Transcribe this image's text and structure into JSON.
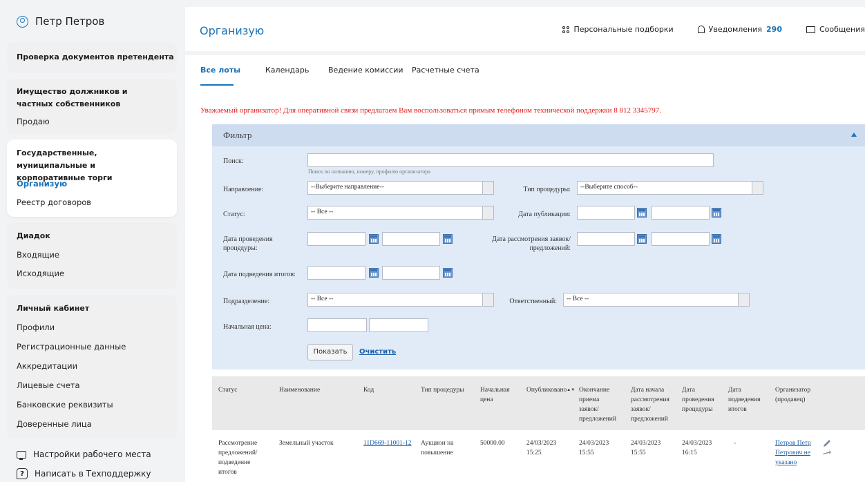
{
  "sidebar": {
    "user_name": "Петр Петров",
    "check_docs": "Проверка документов претендента",
    "property_title": "Имущество должников и частных собственников",
    "sell": "Продаю",
    "gov_title": "Государственные, муниципальные и корпоративные торги",
    "organize": "Организую",
    "contracts": "Реестр договоров",
    "diadoc_title": "Диадок",
    "incoming": "Входящие",
    "outgoing": "Исходящие",
    "cabinet_title": "Личный кабинет",
    "profiles": "Профили",
    "reg_data": "Регистрационные данные",
    "accreditation": "Аккредитации",
    "accounts": "Лицевые счета",
    "bank": "Банковские реквизиты",
    "trusted": "Доверенные лица",
    "workplace": "Настройки рабочего места",
    "support": "Написать в Техподдержку"
  },
  "header": {
    "title": "Организую",
    "personal": "Персональные подборки",
    "notifications": "Уведомления",
    "notifications_count": "290",
    "messages": "Сообщения"
  },
  "tabs": {
    "all_lots": "Все лоты",
    "calendar": "Календарь",
    "commission": "Ведение комиссии",
    "accounts": "Расчетные счета"
  },
  "notice": "Уважаемый организатор! Для оперативной связи предлагаем Вам воспользоваться прямым телефоном технической поддержки 8 812 3345797.",
  "filter": {
    "title": "Фильтр",
    "search_label": "Поиск:",
    "search_hint": "Поиск по названию, номеру, профилю организатора",
    "direction_label": "Направление:",
    "direction_value": "--Выберите направление--",
    "proc_type_label": "Тип процедуры:",
    "proc_type_value": "--Выберите способ--",
    "status_label": "Статус:",
    "status_value": "-- Все --",
    "pub_date_label": "Дата публикации:",
    "proc_date_label": "Дата проведения процедуры:",
    "review_date_label": "Дата рассмотрения заявок/предложений:",
    "results_date_label": "Дата подведения итогов:",
    "division_label": "Подразделение:",
    "division_value": "-- Все --",
    "responsible_label": "Ответственный:",
    "responsible_value": "-- Все --",
    "start_price_label": "Начальная цена:",
    "show_button": "Показать",
    "clear_link": "Очистить"
  },
  "table": {
    "headers": {
      "status": "Статус",
      "name": "Наименование",
      "code": "Код",
      "proc_type": "Тип процедуры",
      "start_price": "Начальная цена",
      "published": "Опубликовано",
      "end_accept": "Окончание приема заявок/ предложений",
      "review_start": "Дата начала рассмотрения заявок/ предложений",
      "proc_date": "Дата проведения процедуры",
      "results_date": "Дата подведения итогов",
      "organizer": "Организатор (продавец)"
    },
    "rows": [
      {
        "status": "Рассмотрение предложений/ подведение итогов",
        "name": "Земельный участок",
        "code": "11D669-11001-12",
        "proc_type": "Аукцион на повышение",
        "start_price": "50000.00",
        "published": "24/03/2023 15:25",
        "end_accept": "24/03/2023 15:55",
        "review_start": "24/03/2023 15:55",
        "proc_date": "24/03/2023 16:15",
        "results_date": "-",
        "organizer": "Петров Петр Петрович не указано"
      }
    ]
  }
}
